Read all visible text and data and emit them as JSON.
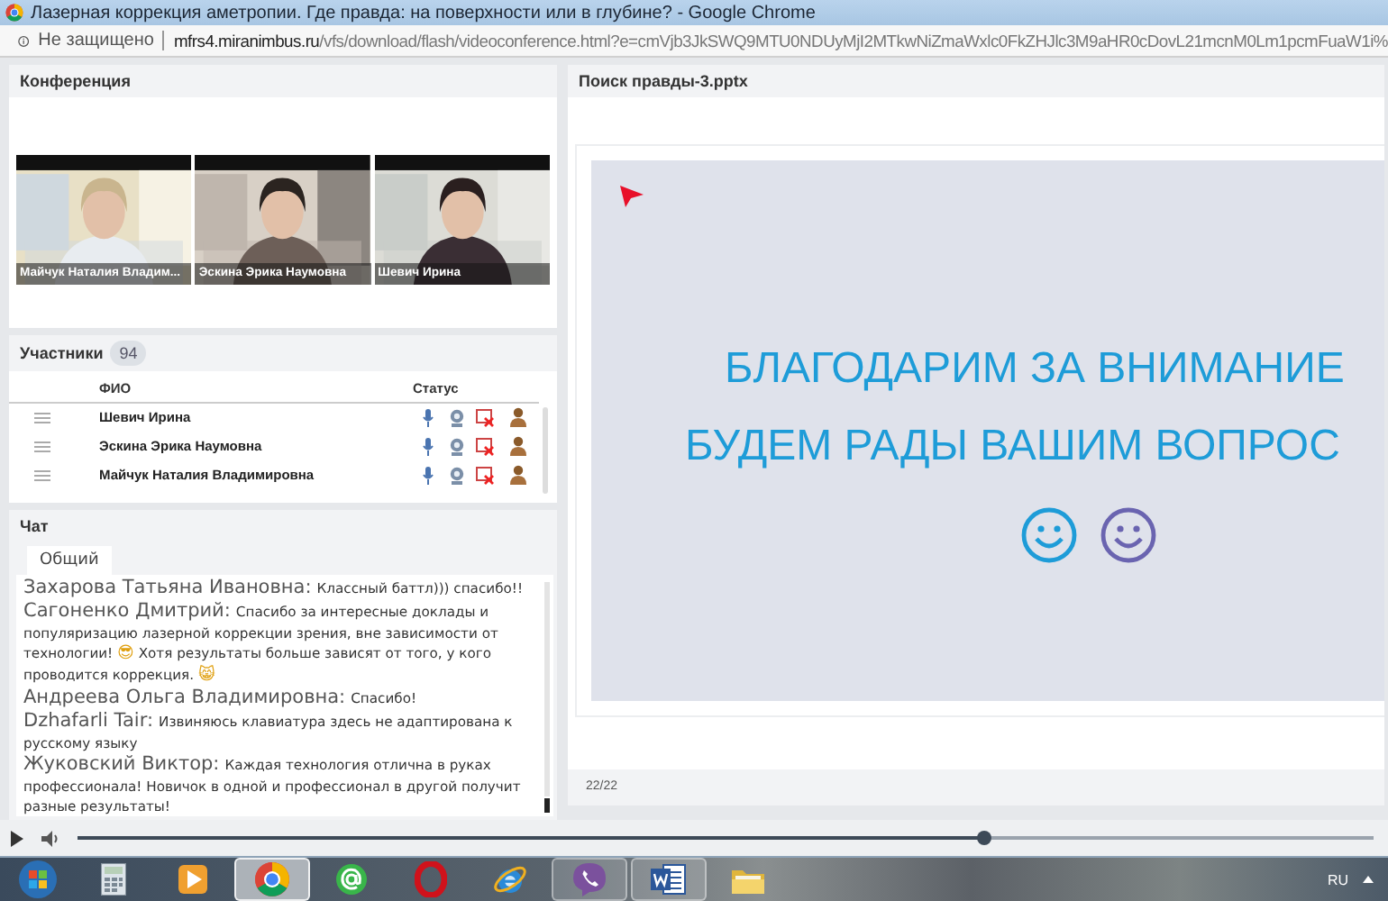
{
  "window": {
    "title": "Лазерная коррекция аметропии. Где правда: на поверхности или в глубине? - Google Chrome"
  },
  "address_bar": {
    "security": "Не защищено",
    "url_host": "mfrs4.miranimbus.ru",
    "url_path": "/vfs/download/flash/videoconference.html?e=cmVjb3JkSWQ9MTU0NDUyMjI2MTkwNiZmaWxlc0FkZHJlc3M9aHR0cDovL21mcnM0Lm1pcmFuaW1i%"
  },
  "conference": {
    "title": "Конференция",
    "videos": [
      {
        "name": "Майчук Наталия Владим..."
      },
      {
        "name": "Эскина Эрика Наумовна"
      },
      {
        "name": "Шевич Ирина"
      }
    ]
  },
  "participants": {
    "title": "Участники",
    "count": "94",
    "columns": [
      "ФИО",
      "Статус"
    ],
    "rows": [
      {
        "name": "Шевич Ирина"
      },
      {
        "name": "Эскина Эрика Наумовна"
      },
      {
        "name": "Майчук Наталия Владимировна"
      }
    ]
  },
  "chat": {
    "title": "Чат",
    "tabs": [
      {
        "label": "Общий",
        "selected": true
      }
    ],
    "messages": [
      {
        "author": "Захарова Татьяна Ивановна:",
        "parts": [
          {
            "kind": "text",
            "text": "Классный баттл))) спасибо!!"
          }
        ]
      },
      {
        "author": "Сагоненко Дмитрий:",
        "parts": [
          {
            "kind": "text",
            "text": "Спасибо за интересные доклады и популяризацию лазерной коррекции зрения, вне зависимости от технологии! "
          },
          {
            "kind": "emoji",
            "text": "😎"
          },
          {
            "kind": "text",
            "text": " Хотя результаты больше зависят от того, у кого проводится коррекция. "
          },
          {
            "kind": "emoji",
            "text": "😸"
          }
        ]
      },
      {
        "author": "Андреева Ольга Владимировна:",
        "parts": [
          {
            "kind": "text",
            "text": "Спасибо!"
          }
        ]
      },
      {
        "author": "Dzhafarli Tair:",
        "parts": [
          {
            "kind": "text",
            "text": "Извиняюсь клавиатура здесь не адаптирована к русскому языку"
          }
        ]
      },
      {
        "author": "Жуковский Виктор:",
        "parts": [
          {
            "kind": "text",
            "text": "Каждая технология отлична в руках профессионала! Новичок в одной и профессионал в другой получит разные результаты!"
          }
        ]
      }
    ]
  },
  "presentation": {
    "title": "Поиск правды-3.pptx",
    "slide_lines": [
      "БЛАГОДАРИМ ЗА ВНИМАНИЕ",
      "БУДЕМ РАДЫ ВАШИМ ВОПРОС"
    ],
    "page": "22/22"
  },
  "player": {
    "level": 0.7
  },
  "taskbar": {
    "language": "RU",
    "items": [
      {
        "kind": "start",
        "open": false,
        "selected": false
      },
      {
        "kind": "calculator",
        "open": false,
        "selected": false
      },
      {
        "kind": "player",
        "open": false,
        "selected": false
      },
      {
        "kind": "browser",
        "open": true,
        "selected": true
      },
      {
        "kind": "mail",
        "open": false,
        "selected": false
      },
      {
        "kind": "red-ring",
        "open": false,
        "selected": false
      },
      {
        "kind": "globe",
        "open": false,
        "selected": false
      },
      {
        "kind": "messenger",
        "open": true,
        "selected": false
      },
      {
        "kind": "word",
        "open": true,
        "selected": false
      },
      {
        "kind": "folder",
        "open": false,
        "selected": false
      }
    ]
  }
}
